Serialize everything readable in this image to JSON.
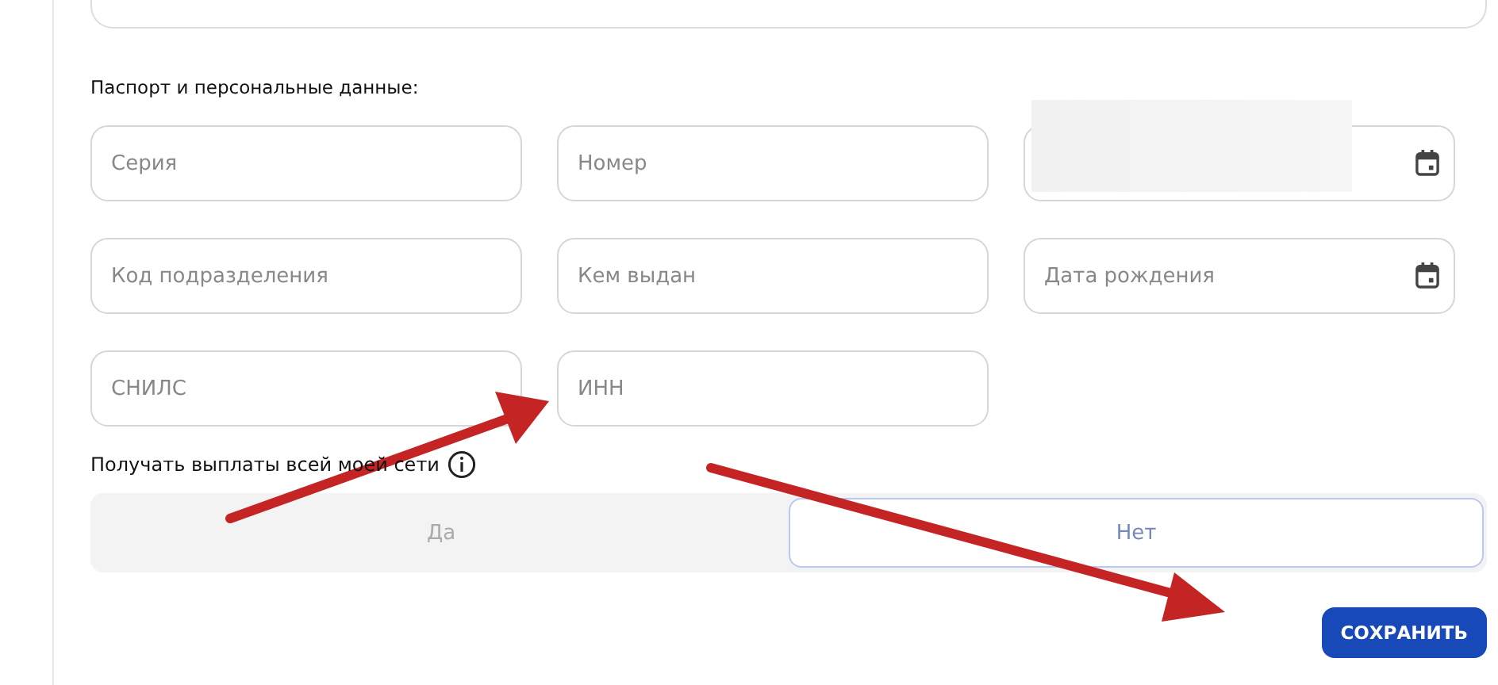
{
  "section_title": "Паспорт и персональные данные:",
  "fields": [
    {
      "kind": "text",
      "placeholder": "Серия"
    },
    {
      "kind": "text",
      "placeholder": "Номер"
    },
    {
      "kind": "date",
      "redacted": true
    },
    {
      "kind": "text",
      "placeholder": "Код подразделения"
    },
    {
      "kind": "text",
      "placeholder": "Кем выдан"
    },
    {
      "kind": "date",
      "placeholder": "Дата рождения"
    },
    {
      "kind": "text",
      "placeholder": "СНИЛС"
    },
    {
      "kind": "text",
      "placeholder": "ИНН"
    }
  ],
  "payout_label": "Получать выплаты всей моей сети",
  "payout_options": [
    {
      "label": "Да",
      "selected": false
    },
    {
      "label": "Нет",
      "selected": true
    }
  ],
  "save_button": "СОХРАНИТЬ"
}
